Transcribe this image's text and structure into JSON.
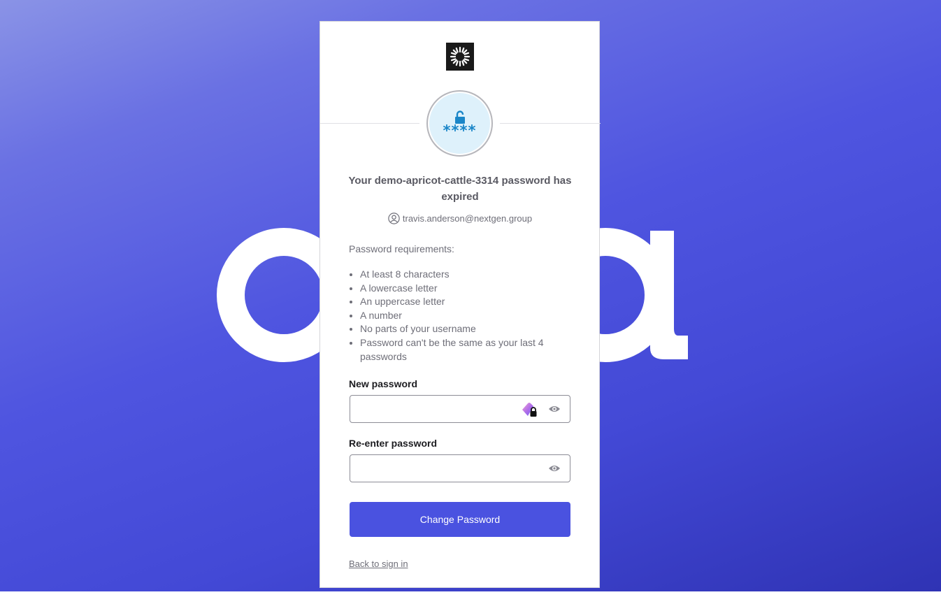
{
  "brand": {
    "accent": "#4a52e0",
    "background_wordmark": "okta"
  },
  "card": {
    "logo_icon": "sunburst-logo-icon",
    "factor_icon": "password-lock-icon",
    "factor_text": "****",
    "title": "Your demo-apricot-cattle-3314 password has expired",
    "identifier_icon": "user-circle-icon",
    "identifier": "travis.anderson@nextgen.group",
    "requirements_heading": "Password requirements:",
    "requirements": [
      "At least 8 characters",
      "A lowercase letter",
      "An uppercase letter",
      "A number",
      "No parts of your username",
      "Password can't be the same as your last 4 passwords"
    ],
    "new_password": {
      "label": "New password",
      "value": ""
    },
    "reenter_password": {
      "label": "Re-enter password",
      "value": ""
    },
    "submit_label": "Change Password",
    "back_link": "Back to sign in"
  }
}
